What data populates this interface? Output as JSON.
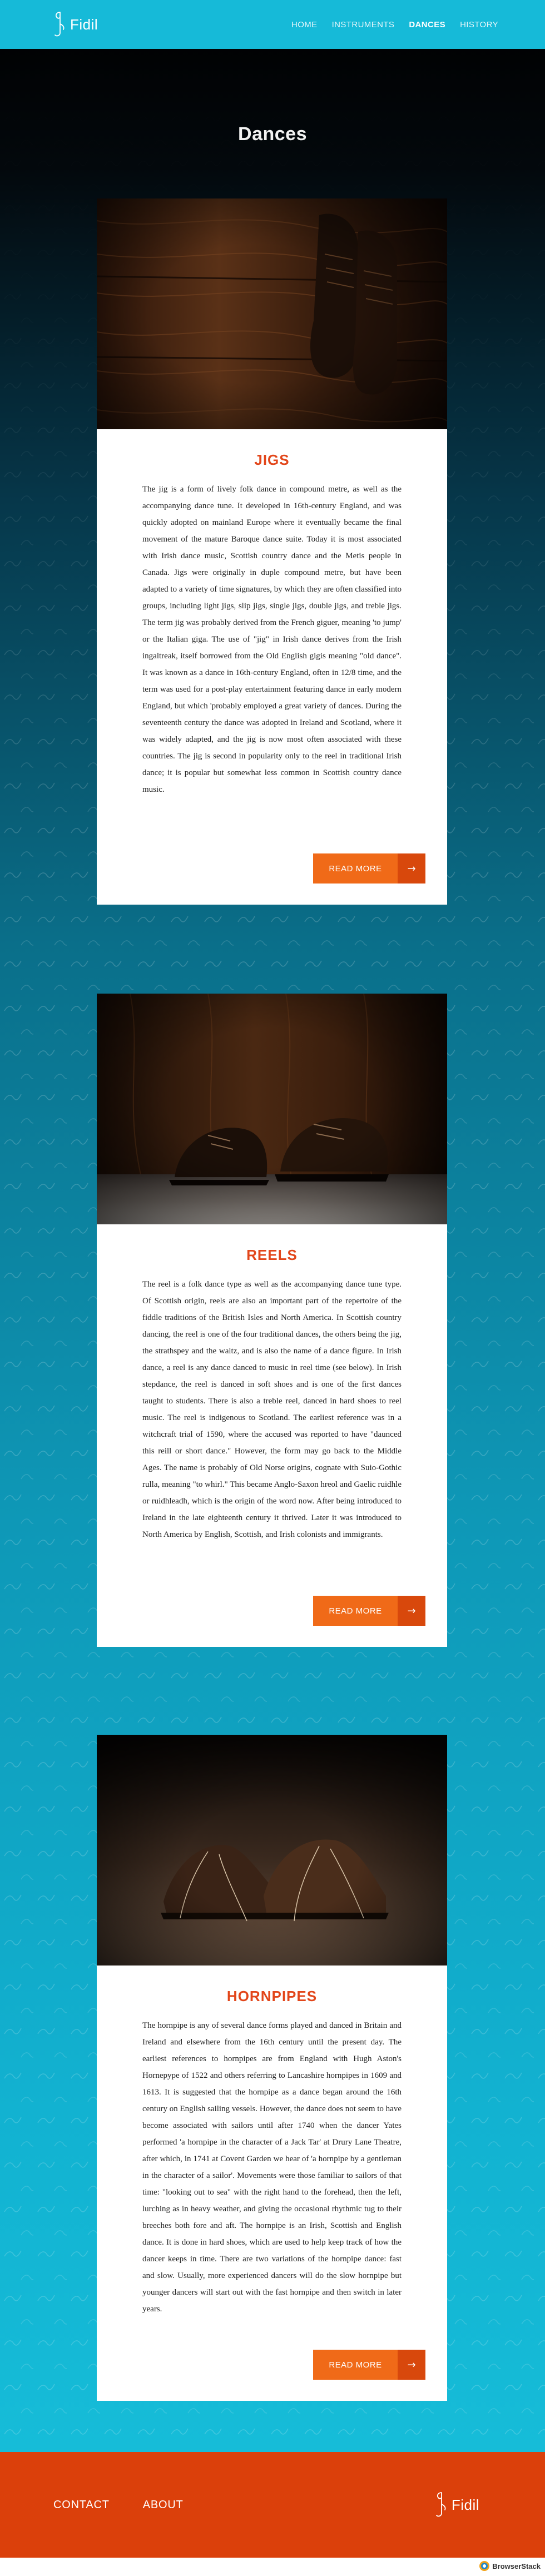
{
  "brand": {
    "name": "Fidil"
  },
  "nav": {
    "items": [
      {
        "label": "HOME",
        "active": false
      },
      {
        "label": "INSTRUMENTS",
        "active": false
      },
      {
        "label": "DANCES",
        "active": true
      },
      {
        "label": "HISTORY",
        "active": false
      }
    ]
  },
  "page": {
    "title": "Dances"
  },
  "sections": [
    {
      "title": "JIGS",
      "image_icon": "dance-shoes-on-wood-photo",
      "text": "The jig is a form of lively folk dance in compound metre, as well as the accompanying dance tune. It developed in 16th-century England, and was quickly adopted on mainland Europe where it eventually became the final movement of the mature Baroque dance suite. Today it is most associated with Irish dance music, Scottish country dance and the Metis people in Canada. Jigs were originally in duple compound metre, but have been adapted to a variety of time signatures, by which they are often classified into groups, including light jigs, slip jigs, single jigs, double jigs, and treble jigs. The term jig was probably derived from the French giguer, meaning 'to jump' or the Italian giga. The use of \"jig\" in Irish dance derives from the Irish ingaltreak, itself borrowed from the Old English gigis meaning \"old dance\". It was known as a dance in 16th-century England, often in 12/8 time, and the term was used for a post-play entertainment featuring dance in early modern England, but which 'probably employed a great variety of dances. During the seventeenth century the dance was adopted in Ireland and Scotland, where it was widely adapted, and the jig is now most often associated with these countries. The jig is second in popularity only to the reel in traditional Irish dance; it is popular but somewhat less common in Scottish country dance music.",
      "button": "READ MORE"
    },
    {
      "title": "REELS",
      "image_icon": "hard-shoes-photo",
      "text": "The reel is a folk dance type as well as the accompanying dance tune type. Of Scottish origin, reels are also an important part of the repertoire of the fiddle traditions of the British Isles and North America. In Scottish country dancing, the reel is one of the four traditional dances, the others being the jig, the strathspey and the waltz, and is also the name of a dance figure. In Irish dance, a reel is any dance danced to music in reel time (see below). In Irish stepdance, the reel is danced in soft shoes and is one of the first dances taught to students. There is also a treble reel, danced in hard shoes to reel music. The reel is indigenous to Scotland. The earliest reference was in a witchcraft trial of 1590, where the accused was reported to have \"daunced this reill or short dance.\" However, the form may go back to the Middle Ages. The name is probably of Old Norse origins, cognate with Suio-Gothic rulla, meaning \"to whirl.\" This became Anglo-Saxon hreol and Gaelic ruidhle or ruidhleadh, which is the origin of the word now. After being introduced to Ireland in the late eighteenth century it thrived. Later it was introduced to North America by English, Scottish, and Irish colonists and immigrants.",
      "button": "READ MORE"
    },
    {
      "title": "HORNPIPES",
      "image_icon": "tap-shoes-photo",
      "text": "The hornpipe is any of several dance forms played and danced in Britain and Ireland and elsewhere from the 16th century until the present day. The earliest references to hornpipes are from England with Hugh Aston's Hornepype of 1522 and others referring to Lancashire hornpipes in 1609 and 1613. It is suggested that the hornpipe as a dance began around the 16th century on English sailing vessels. However, the dance does not seem to have become associated with sailors until after 1740 when the dancer Yates performed 'a hornpipe in the character of a Jack Tar' at Drury Lane Theatre, after which, in 1741 at Covent Garden we hear of 'a hornpipe by a gentleman in the character of a sailor'. Movements were those familiar to sailors of that time: \"looking out to sea\" with the right hand to the forehead, then the left, lurching as in heavy weather, and giving the occasional rhythmic tug to their breeches both fore and aft. The hornpipe is an Irish, Scottish and English dance. It is done in hard shoes, which are used to help keep track of how the dancer keeps in time. There are two variations of the hornpipe dance: fast and slow. Usually, more experienced dancers will do the slow hornpipe but younger dancers will start out with the fast hornpipe and then switch in later years.",
      "button": "READ MORE"
    }
  ],
  "footer": {
    "links": [
      {
        "label": "CONTACT"
      },
      {
        "label": "ABOUT"
      }
    ],
    "brand": "Fidil"
  },
  "badge": {
    "label": "BrowserStack"
  },
  "colors": {
    "header": "#16bad8",
    "accent": "#e2461a",
    "button": "#f06a18",
    "footer": "#db400b"
  }
}
